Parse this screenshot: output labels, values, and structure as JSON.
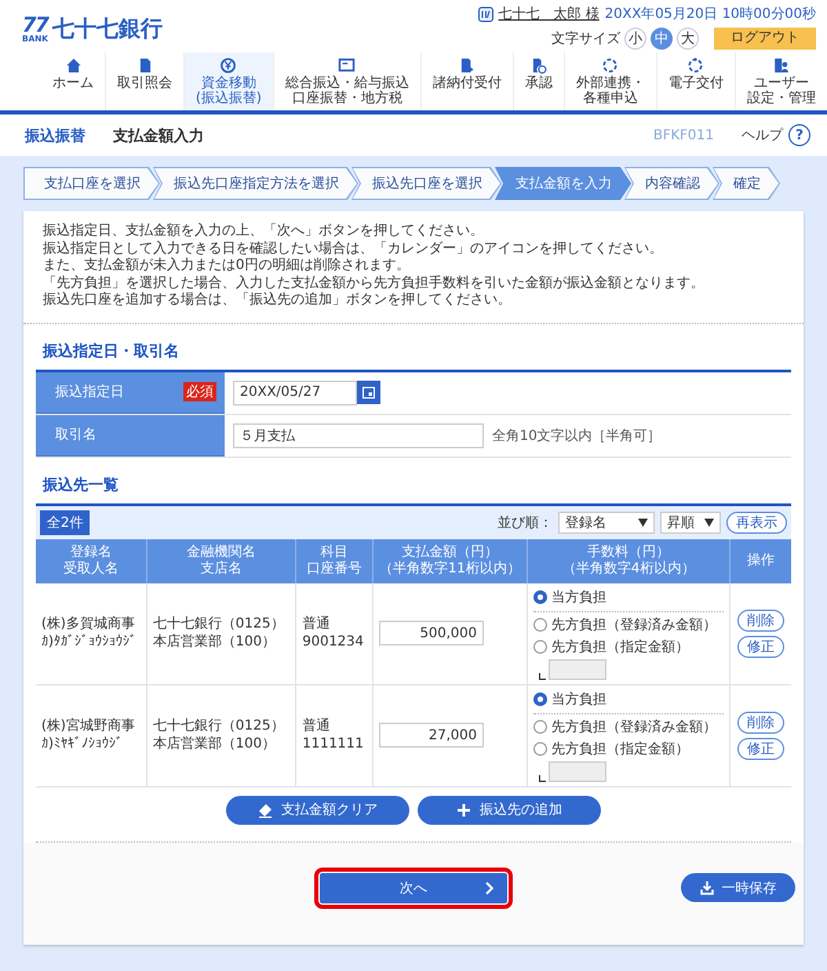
{
  "header": {
    "logo_mark": "77",
    "logo_sub": "BANK",
    "bank_name": "七十七銀行",
    "user_name": "七十七　太郎 様",
    "datetime": "20XX年05月20日 10時00分00秒",
    "font_size_label": "文字サイズ",
    "font_sizes": [
      {
        "label": "小",
        "selected": false
      },
      {
        "label": "中",
        "selected": true
      },
      {
        "label": "大",
        "selected": false
      }
    ],
    "logout": "ログアウト"
  },
  "nav": [
    {
      "lines": [
        "ホーム"
      ],
      "selected": false
    },
    {
      "lines": [
        "取引照会"
      ],
      "selected": false
    },
    {
      "lines": [
        "資金移動",
        "(振込振替)"
      ],
      "selected": true
    },
    {
      "lines": [
        "総合振込・給与振込",
        "口座振替・地方税"
      ],
      "selected": false
    },
    {
      "lines": [
        "諸納付受付"
      ],
      "selected": false
    },
    {
      "lines": [
        "承認"
      ],
      "selected": false
    },
    {
      "lines": [
        "外部連携・",
        "各種申込"
      ],
      "selected": false
    },
    {
      "lines": [
        "電子交付"
      ],
      "selected": false
    },
    {
      "lines": [
        "ユーザー",
        "設定・管理"
      ],
      "selected": false
    }
  ],
  "page_title": {
    "category": "振込振替",
    "title": "支払金額入力",
    "screen_id": "BFKF011",
    "help": "ヘルプ",
    "help_icon": "?"
  },
  "steps": [
    {
      "label": "支払口座を選択",
      "selected": false
    },
    {
      "label": "振込先口座指定方法を選択",
      "selected": false
    },
    {
      "label": "振込先口座を選択",
      "selected": false
    },
    {
      "label": "支払金額を入力",
      "selected": true
    },
    {
      "label": "内容確認",
      "selected": false
    },
    {
      "label": "確定",
      "selected": false
    }
  ],
  "instructions": [
    "振込指定日、支払金額を入力の上、「次へ」ボタンを押してください。",
    "振込指定日として入力できる日を確認したい場合は、「カレンダー」のアイコンを押してください。",
    "また、支払金額が未入力または0円の明細は削除されます。",
    "「先方負担」を選択した場合、入力した支払金額から先方負担手数料を引いた金額が振込金額となります。",
    "振込先口座を追加する場合は、「振込先の追加」ボタンを押してください。"
  ],
  "transfer_info": {
    "heading": "振込指定日・取引名",
    "fields": [
      {
        "kind": "date",
        "label": "振込指定日",
        "required_badge": "必須",
        "value": "20XX/05/27"
      },
      {
        "kind": "text",
        "label": "取引名",
        "value": "５月支払",
        "hint": "全角10文字以内［半角可］"
      }
    ]
  },
  "payee_list": {
    "heading": "振込先一覧",
    "count": "全2件",
    "sort_label": "並び順：",
    "sort_field": "登録名",
    "sort_order": "昇順",
    "refresh": "再表示",
    "columns": [
      {
        "lines": [
          "登録名",
          "受取人名"
        ]
      },
      {
        "lines": [
          "金融機関名",
          "支店名"
        ]
      },
      {
        "lines": [
          "科目",
          "口座番号"
        ]
      },
      {
        "lines": [
          "支払金額（円）",
          "（半角数字11桁以内）"
        ]
      },
      {
        "lines": [
          "手数料（円）",
          "（半角数字4桁以内）"
        ]
      },
      {
        "lines": [
          "操作"
        ]
      }
    ],
    "rows": [
      {
        "name": "(株)多賀城商事",
        "kana": "ｶ)ﾀｶﾞｼﾞｮｳｼｮｳｼﾞ",
        "bank": "七十七銀行（0125）",
        "branch": "本店営業部（100）",
        "account_type": "普通",
        "account_number": "9001234",
        "amount": "500,000",
        "fee_options": [
          {
            "label": "当方負担",
            "selected": true
          },
          {
            "label": "先方負担（登録済み金額）",
            "selected": false
          },
          {
            "label": "先方負担（指定金額）",
            "selected": false
          }
        ],
        "actions": [
          "削除",
          "修正"
        ]
      },
      {
        "name": "(株)宮城野商事",
        "kana": "ｶ)ﾐﾔｷﾞﾉｼｮｳｼﾞ",
        "bank": "七十七銀行（0125）",
        "branch": "本店営業部（100）",
        "account_type": "普通",
        "account_number": "1111111",
        "amount": "27,000",
        "fee_options": [
          {
            "label": "当方負担",
            "selected": true
          },
          {
            "label": "先方負担（登録済み金額）",
            "selected": false
          },
          {
            "label": "先方負担（指定金額）",
            "selected": false
          }
        ],
        "actions": [
          "削除",
          "修正"
        ]
      }
    ],
    "buttons": [
      {
        "kind": "clear",
        "label": "支払金額クリア"
      },
      {
        "kind": "add",
        "label": "振込先の追加"
      }
    ]
  },
  "footer": {
    "next": "次へ",
    "next_highlighted": true,
    "save": "一時保存"
  }
}
